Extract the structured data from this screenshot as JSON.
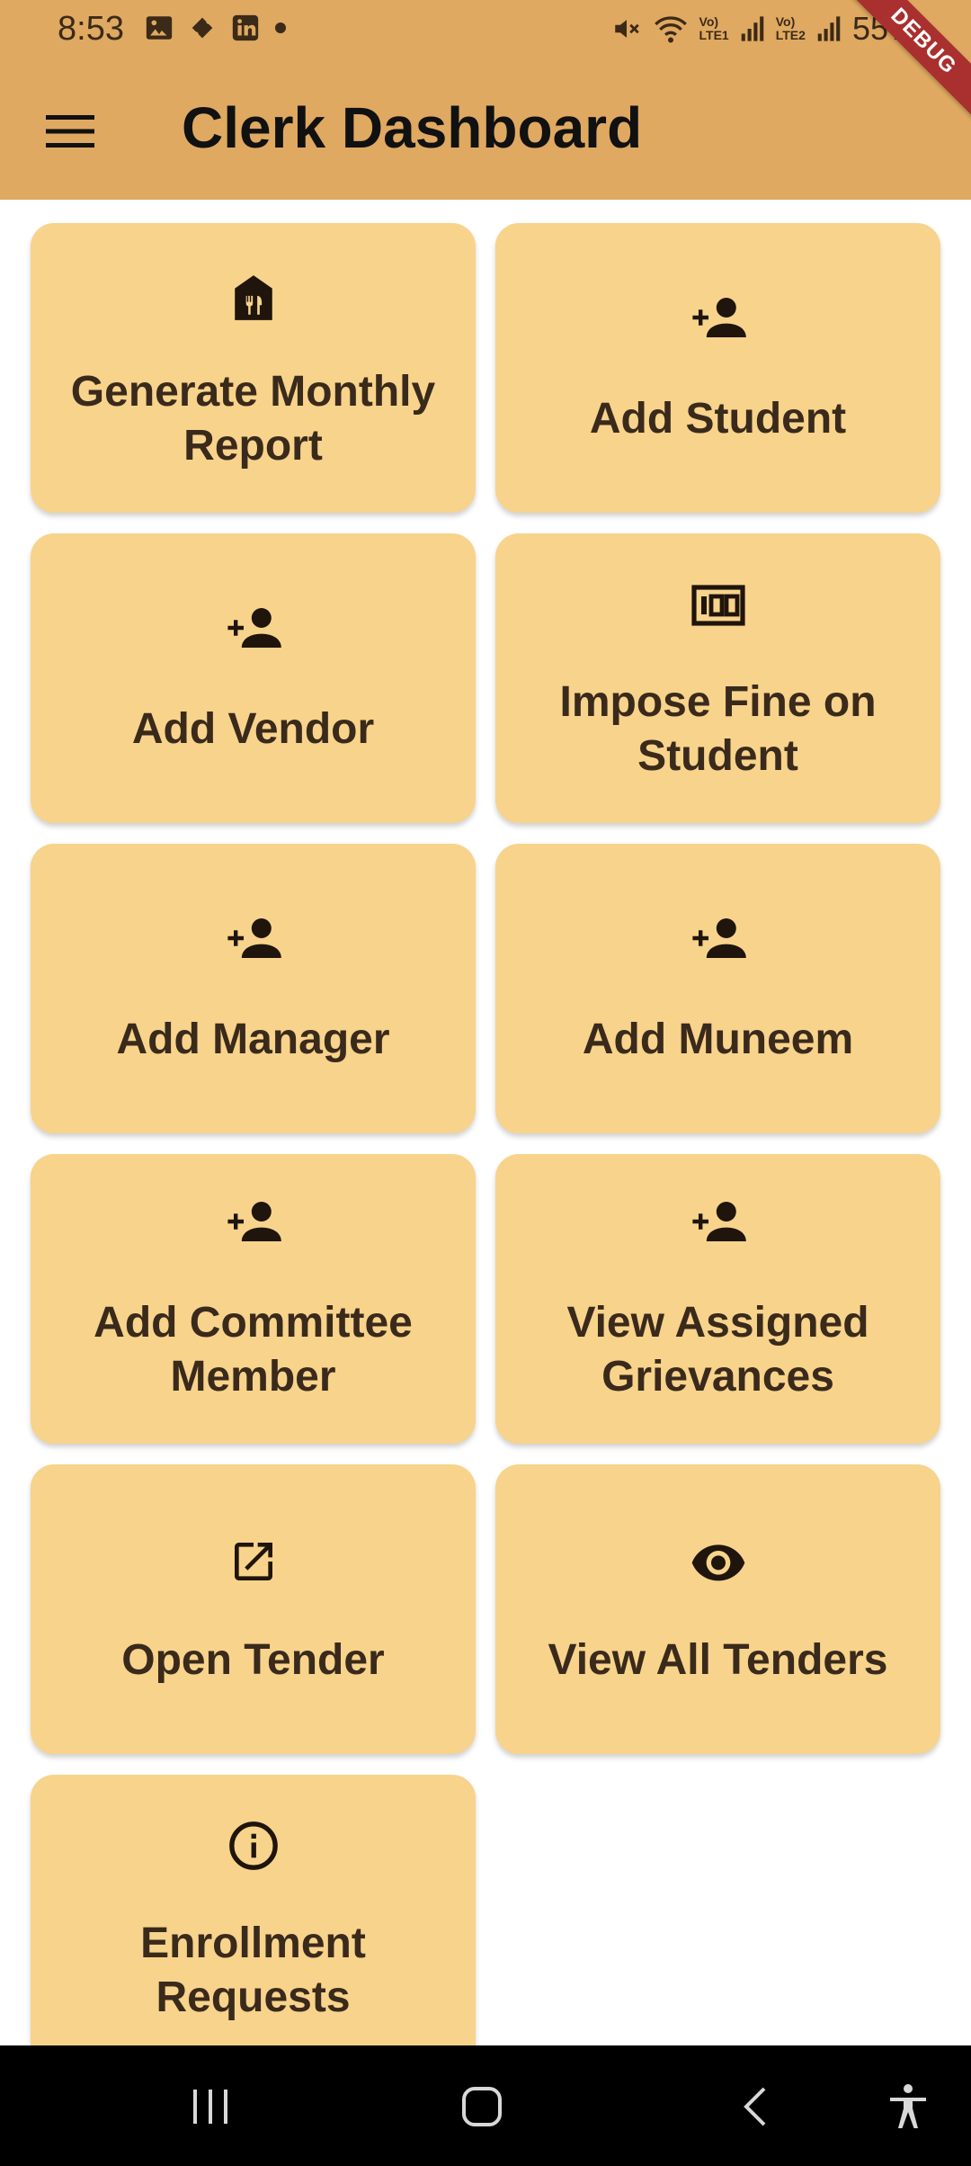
{
  "status_bar": {
    "time": "8:53",
    "battery": "55%",
    "sim1_label_top": "Vo)",
    "sim1_label_bottom": "LTE1",
    "sim2_label_top": "Vo)",
    "sim2_label_bottom": "LTE2",
    "debug_banner": "DEBUG"
  },
  "app_bar": {
    "title": "Clerk Dashboard",
    "background_color": "#DFA961"
  },
  "cards": [
    {
      "label": "Generate Monthly Report",
      "icon": "restaurant-store-icon"
    },
    {
      "label": "Add Student",
      "icon": "person-add-icon"
    },
    {
      "label": "Add Vendor",
      "icon": "person-add-icon"
    },
    {
      "label": "Impose Fine on Student",
      "icon": "money-icon"
    },
    {
      "label": "Add Manager",
      "icon": "person-add-icon"
    },
    {
      "label": "Add Muneem",
      "icon": "person-add-icon"
    },
    {
      "label": "Add Committee Member",
      "icon": "person-add-icon"
    },
    {
      "label": "View Assigned Grievances",
      "icon": "person-add-icon"
    },
    {
      "label": "Open Tender",
      "icon": "open-in-new-icon"
    },
    {
      "label": "View All Tenders",
      "icon": "eye-icon"
    },
    {
      "label": "Enrollment Requests",
      "icon": "info-icon"
    }
  ],
  "card_color": "#F8D38B",
  "nav_bar": {
    "items": [
      "recents-icon",
      "home-icon",
      "back-icon",
      "accessibility-icon"
    ]
  }
}
